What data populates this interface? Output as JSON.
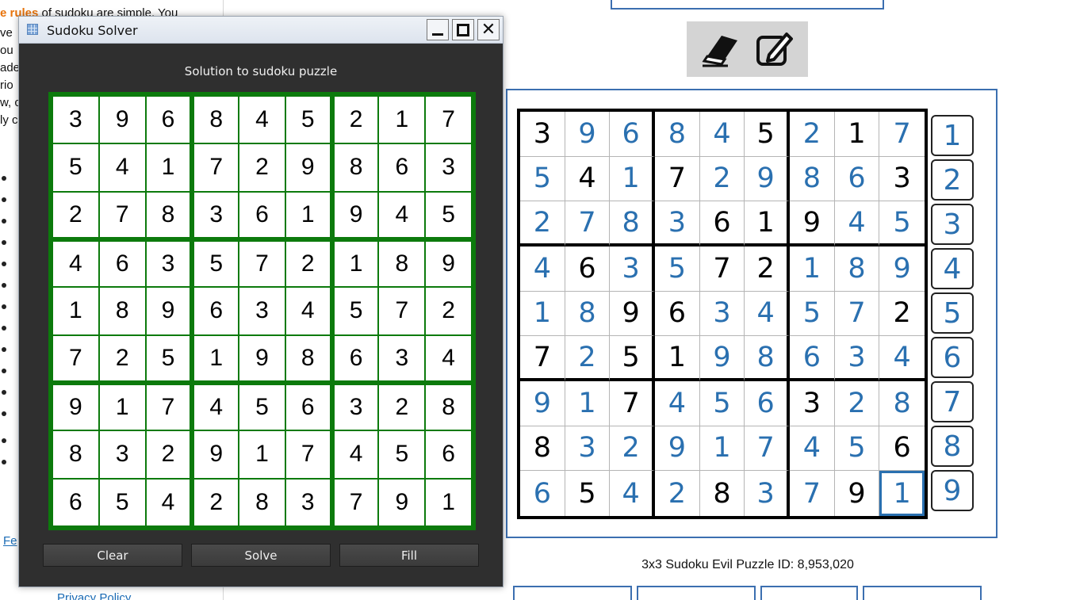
{
  "background_page": {
    "rules_lead": "e rules",
    "rules_text": " of sudoku are simple. You",
    "left_fragments": [
      "ve",
      "ou",
      "ade",
      "rio",
      "w, c",
      "ly c"
    ],
    "link_text": "Fe",
    "privacy_text": "Privacy Policy"
  },
  "web_puzzle": {
    "grid": [
      [
        3,
        9,
        6,
        8,
        4,
        5,
        2,
        1,
        7
      ],
      [
        5,
        4,
        1,
        7,
        2,
        9,
        8,
        6,
        3
      ],
      [
        2,
        7,
        8,
        3,
        6,
        1,
        9,
        4,
        5
      ],
      [
        4,
        6,
        3,
        5,
        7,
        2,
        1,
        8,
        9
      ],
      [
        1,
        8,
        9,
        6,
        3,
        4,
        5,
        7,
        2
      ],
      [
        7,
        2,
        5,
        1,
        9,
        8,
        6,
        3,
        4
      ],
      [
        9,
        1,
        7,
        4,
        5,
        6,
        3,
        2,
        8
      ],
      [
        8,
        3,
        2,
        9,
        1,
        7,
        4,
        5,
        6
      ],
      [
        6,
        5,
        4,
        2,
        8,
        3,
        7,
        9,
        1
      ]
    ],
    "givens": [
      [
        1,
        0,
        0,
        0,
        0,
        1,
        0,
        1,
        0
      ],
      [
        0,
        1,
        0,
        1,
        0,
        0,
        0,
        0,
        1
      ],
      [
        0,
        0,
        0,
        0,
        1,
        1,
        1,
        0,
        0
      ],
      [
        0,
        1,
        0,
        0,
        1,
        1,
        0,
        0,
        0
      ],
      [
        0,
        0,
        1,
        1,
        0,
        0,
        0,
        0,
        1
      ],
      [
        1,
        0,
        1,
        1,
        0,
        0,
        0,
        0,
        0
      ],
      [
        0,
        0,
        1,
        0,
        0,
        0,
        1,
        0,
        0
      ],
      [
        1,
        0,
        0,
        0,
        0,
        0,
        0,
        0,
        1
      ],
      [
        0,
        1,
        0,
        0,
        1,
        0,
        0,
        1,
        0
      ]
    ],
    "selected_cell": [
      8,
      8
    ],
    "numpad": [
      "1",
      "2",
      "3",
      "4",
      "5",
      "6",
      "7",
      "8",
      "9"
    ],
    "puzzle_id_text": "3x3 Sudoku Evil Puzzle ID: 8,953,020",
    "colors": {
      "entered": "#2a70b0",
      "given": "#000000",
      "frame": "#3c6fb0"
    }
  },
  "solver_window": {
    "title": "Sudoku Solver",
    "heading": "Solution to sudoku puzzle",
    "grid": [
      [
        3,
        9,
        6,
        8,
        4,
        5,
        2,
        1,
        7
      ],
      [
        5,
        4,
        1,
        7,
        2,
        9,
        8,
        6,
        3
      ],
      [
        2,
        7,
        8,
        3,
        6,
        1,
        9,
        4,
        5
      ],
      [
        4,
        6,
        3,
        5,
        7,
        2,
        1,
        8,
        9
      ],
      [
        1,
        8,
        9,
        6,
        3,
        4,
        5,
        7,
        2
      ],
      [
        7,
        2,
        5,
        1,
        9,
        8,
        6,
        3,
        4
      ],
      [
        9,
        1,
        7,
        4,
        5,
        6,
        3,
        2,
        8
      ],
      [
        8,
        3,
        2,
        9,
        1,
        7,
        4,
        5,
        6
      ],
      [
        6,
        5,
        4,
        2,
        8,
        3,
        7,
        9,
        1
      ]
    ],
    "buttons": {
      "clear": "Clear",
      "solve": "Solve",
      "fill": "Fill"
    },
    "colors": {
      "grid_border": "#0c7a0c",
      "window_bg": "#2f2f2f"
    }
  }
}
